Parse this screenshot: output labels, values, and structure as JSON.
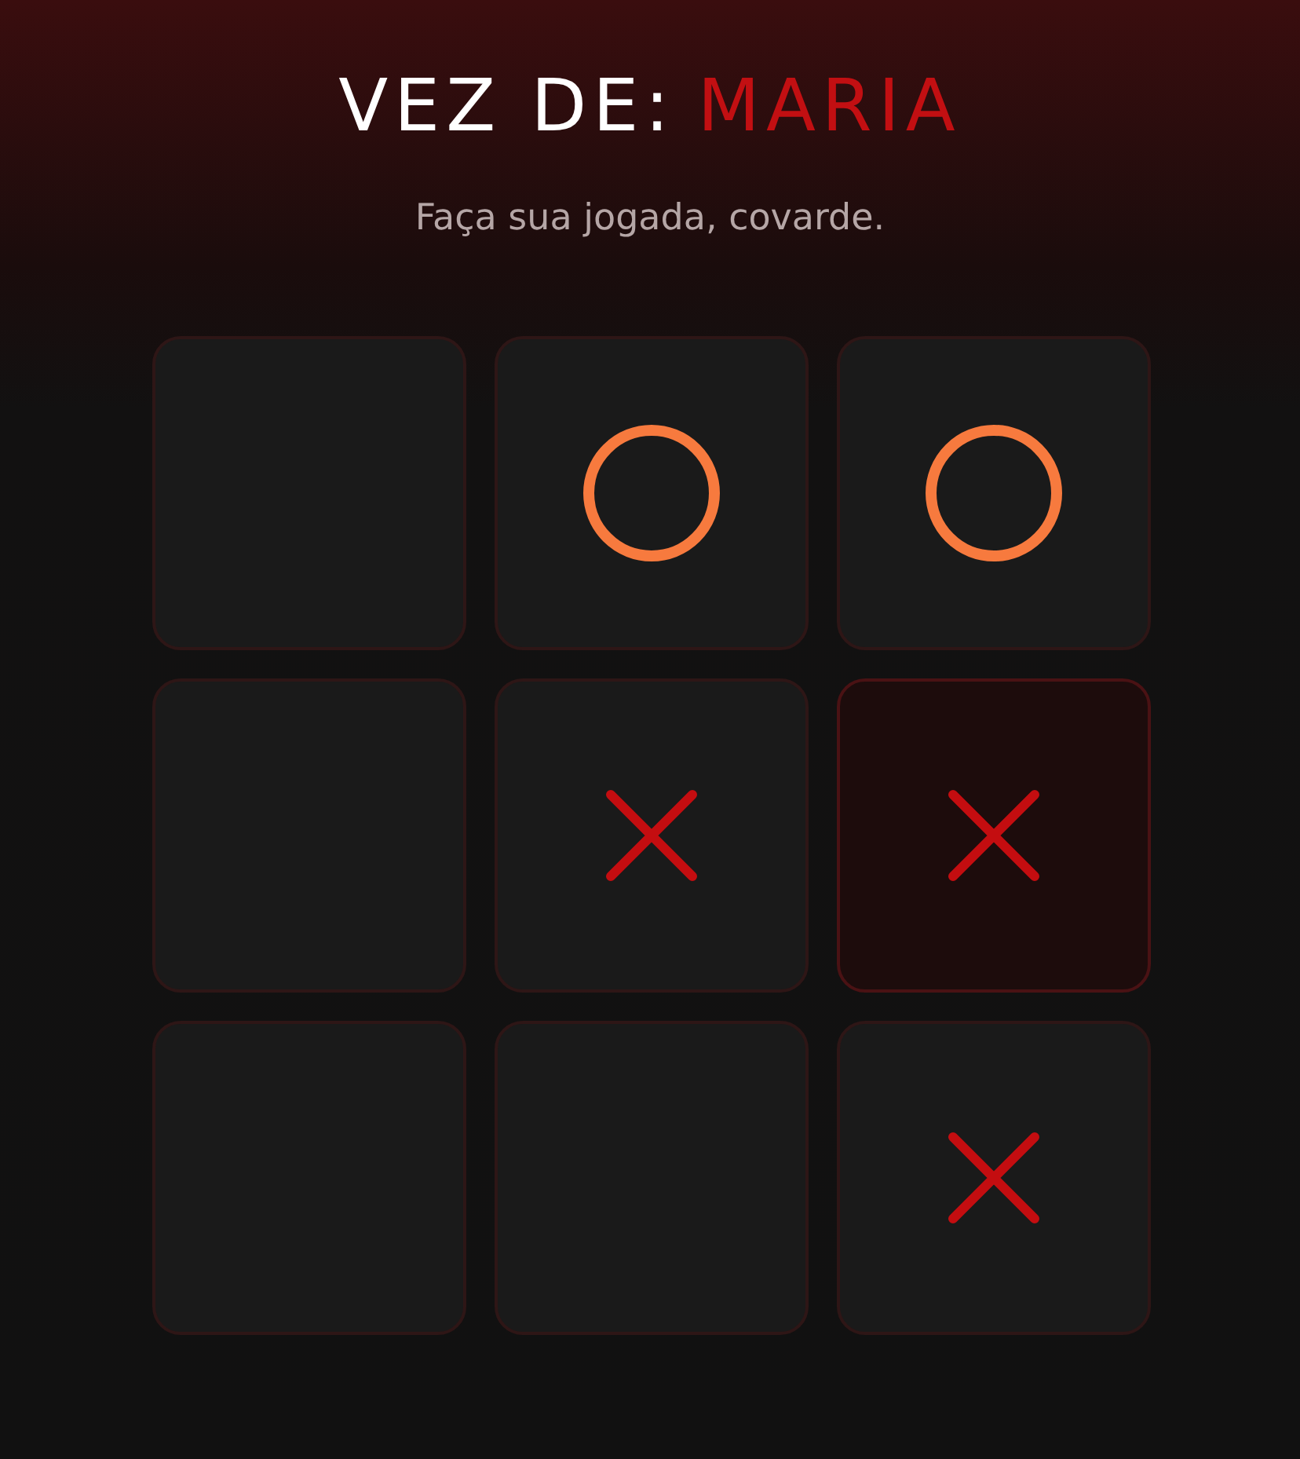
{
  "header": {
    "label": "VEZ DE:",
    "player": "MARIA",
    "subtitle": "Faça sua jogada, covarde."
  },
  "board": [
    {
      "kind": "empty",
      "selected": false
    },
    {
      "kind": "o",
      "selected": false
    },
    {
      "kind": "o",
      "selected": false
    },
    {
      "kind": "empty",
      "selected": false
    },
    {
      "kind": "x",
      "selected": false
    },
    {
      "kind": "x",
      "selected": true
    },
    {
      "kind": "empty",
      "selected": false
    },
    {
      "kind": "empty",
      "selected": false
    },
    {
      "kind": "x",
      "selected": false
    }
  ]
}
